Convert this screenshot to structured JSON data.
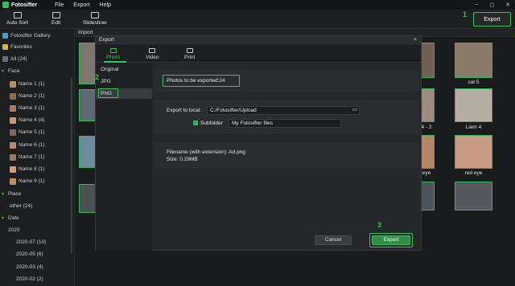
{
  "app": {
    "title": "Fotosifter",
    "menu": [
      "File",
      "Export",
      "Help"
    ],
    "window_buttons": [
      "−",
      "◻",
      "✕"
    ]
  },
  "toolbar": {
    "items": [
      "Auto Sort",
      "Edit",
      "Slideshow"
    ],
    "export_label": "Export"
  },
  "steps": [
    "1",
    "2",
    "3"
  ],
  "sidebar": {
    "gallery": "Fotosifter Gallery",
    "favorites": "Favorites",
    "all": "All (24)",
    "face_header": "Face",
    "faces": [
      "Name 1 (1)",
      "Name 2 (1)",
      "Name 3 (1)",
      "Name 4 (4)",
      "Name 5 (1)",
      "Name 6 (1)",
      "Name 7 (1)",
      "Name 8 (1)",
      "Name 9 (1)"
    ],
    "place_header": "Place",
    "place_items": [
      "other (24)"
    ],
    "date_header": "Date",
    "year": "2020",
    "months": [
      "2020-07 (10)",
      "2020-05 (6)",
      "2020-03 (4)",
      "2020-02 (2)"
    ]
  },
  "content": {
    "import_label": "Import",
    "thumb_labels": [
      "cat 5",
      "4 - 2",
      "Liam 4",
      "eye",
      "red eye"
    ]
  },
  "dialog": {
    "title": "Export",
    "close": "×",
    "tabs": [
      "Photo",
      "Video",
      "Print"
    ],
    "formats": [
      "Original",
      "JPG",
      "PNG"
    ],
    "count_text": "Photos to be exported:24",
    "export_to_label": "Export to local:",
    "path": "C:/Fotosifter/Upload",
    "subfolder_label": "Subfolder",
    "subfolder_value": "My Fotosifter files",
    "filename_text": "Filename (with extension): Ad.png",
    "size_text": "Size: 0.29MB",
    "cancel": "Cancel",
    "export": "Export"
  },
  "colors": {
    "accent": "#36c25a",
    "bg": "#1b1c1e",
    "dialog": "#26272a"
  }
}
